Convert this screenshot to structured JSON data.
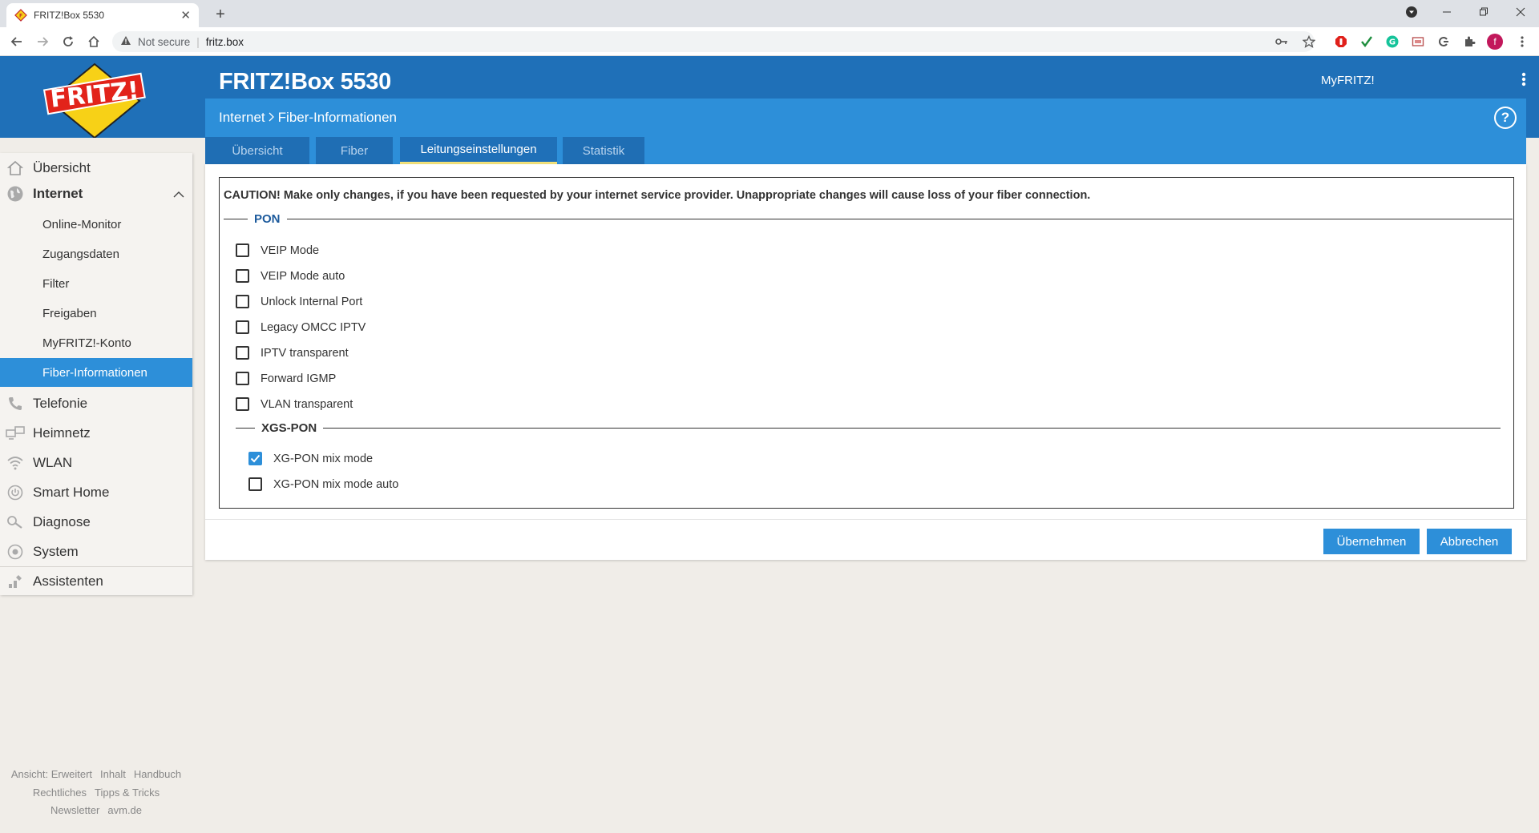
{
  "browser": {
    "tab_title": "FRITZ!Box 5530",
    "tab_close": "✕",
    "new_tab": "+",
    "security_label": "Not secure",
    "url": "fritz.box",
    "profile_initial": "f"
  },
  "header": {
    "product": "FRITZ!Box 5530",
    "myfritz": "MyFRITZ!",
    "brand_color": "#1f70b8"
  },
  "breadcrumb": {
    "section": "Internet",
    "page": "Fiber-Informationen"
  },
  "tabs": [
    {
      "label": "Übersicht"
    },
    {
      "label": "Fiber"
    },
    {
      "label": "Leitungseinstellungen"
    },
    {
      "label": "Statistik"
    }
  ],
  "active_tab": "Leitungseinstellungen",
  "content": {
    "caution": "CAUTION! Make only changes, if you have been requested by your internet service provider. Unappropriate changes will cause loss of your fiber connection.",
    "pon_legend": "PON",
    "pon_options": [
      {
        "label": "VEIP Mode",
        "checked": false
      },
      {
        "label": "VEIP Mode auto",
        "checked": false
      },
      {
        "label": "Unlock Internal Port",
        "checked": false
      },
      {
        "label": "Legacy OMCC IPTV",
        "checked": false
      },
      {
        "label": "IPTV transparent",
        "checked": false
      },
      {
        "label": "Forward IGMP",
        "checked": false
      },
      {
        "label": "VLAN transparent",
        "checked": false
      }
    ],
    "xgs_legend": "XGS-PON",
    "xgs_options": [
      {
        "label": "XG-PON mix mode",
        "checked": true
      },
      {
        "label": "XG-PON mix mode auto",
        "checked": false
      }
    ]
  },
  "buttons": {
    "apply": "Übernehmen",
    "cancel": "Abbrechen"
  },
  "sidebar": {
    "items": [
      {
        "label": "Übersicht",
        "icon": "home-icon"
      },
      {
        "label": "Internet",
        "icon": "globe-icon"
      },
      {
        "label": "Telefonie",
        "icon": "phone-icon"
      },
      {
        "label": "Heimnetz",
        "icon": "network-icon"
      },
      {
        "label": "WLAN",
        "icon": "wifi-icon"
      },
      {
        "label": "Smart Home",
        "icon": "power-icon"
      },
      {
        "label": "Diagnose",
        "icon": "diagnose-icon"
      },
      {
        "label": "System",
        "icon": "system-icon"
      },
      {
        "label": "Assistenten",
        "icon": "assistant-icon"
      }
    ],
    "internet_sub": [
      {
        "label": "Online-Monitor"
      },
      {
        "label": "Zugangsdaten"
      },
      {
        "label": "Filter"
      },
      {
        "label": "Freigaben"
      },
      {
        "label": "MyFRITZ!-Konto"
      },
      {
        "label": "Fiber-Informationen"
      }
    ]
  },
  "footer": {
    "row1": [
      "Ansicht: Erweitert",
      "Inhalt",
      "Handbuch"
    ],
    "row2": [
      "Rechtliches",
      "Tipps & Tricks"
    ],
    "row3": [
      "Newsletter",
      "avm.de"
    ]
  }
}
